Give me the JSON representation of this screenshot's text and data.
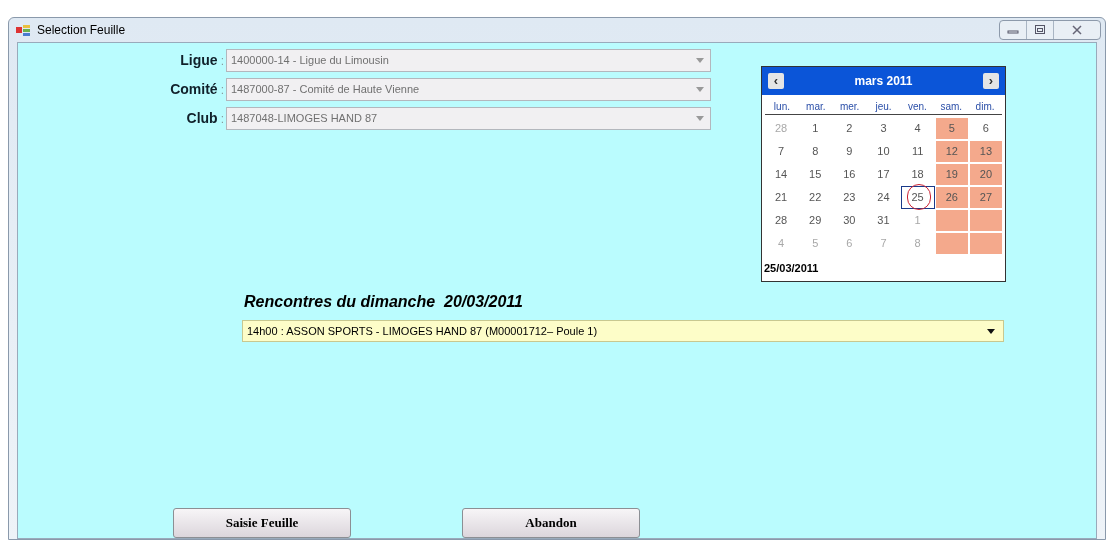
{
  "window": {
    "title": "Selection Feuille"
  },
  "fields": [
    {
      "label": "Ligue",
      "separator": ":",
      "value": "1400000-14 - Ligue du Limousin",
      "disabled": true
    },
    {
      "label": "Comité",
      "separator": ":",
      "value": "1487000-87 - Comité de Haute Vienne",
      "disabled": true
    },
    {
      "label": "Club",
      "separator": ":",
      "value": "1487048-LIMOGES HAND 87",
      "disabled": true
    }
  ],
  "calendar": {
    "month": "mars 2011",
    "prev": "‹",
    "next": "›",
    "weekdays": [
      "lun.",
      "mar.",
      "mer.",
      "jeu.",
      "ven.",
      "sam.",
      "dim."
    ],
    "weeks": [
      [
        {
          "text": "28",
          "other_month": true,
          "weekend": false,
          "selected": false
        },
        {
          "text": "1",
          "other_month": false,
          "weekend": false,
          "selected": false
        },
        {
          "text": "2",
          "other_month": false,
          "weekend": false,
          "selected": false
        },
        {
          "text": "3",
          "other_month": false,
          "weekend": false,
          "selected": false
        },
        {
          "text": "4",
          "other_month": false,
          "weekend": false,
          "selected": false
        },
        {
          "text": "5",
          "other_month": false,
          "weekend": true,
          "selected": false
        },
        {
          "text": "6",
          "other_month": false,
          "weekend": false,
          "selected": false
        }
      ],
      [
        {
          "text": "7",
          "other_month": false,
          "weekend": false,
          "selected": false
        },
        {
          "text": "8",
          "other_month": false,
          "weekend": false,
          "selected": false
        },
        {
          "text": "9",
          "other_month": false,
          "weekend": false,
          "selected": false
        },
        {
          "text": "10",
          "other_month": false,
          "weekend": false,
          "selected": false
        },
        {
          "text": "11",
          "other_month": false,
          "weekend": false,
          "selected": false
        },
        {
          "text": "12",
          "other_month": false,
          "weekend": true,
          "selected": false
        },
        {
          "text": "13",
          "other_month": false,
          "weekend": true,
          "selected": false
        }
      ],
      [
        {
          "text": "14",
          "other_month": false,
          "weekend": false,
          "selected": false
        },
        {
          "text": "15",
          "other_month": false,
          "weekend": false,
          "selected": false
        },
        {
          "text": "16",
          "other_month": false,
          "weekend": false,
          "selected": false
        },
        {
          "text": "17",
          "other_month": false,
          "weekend": false,
          "selected": false
        },
        {
          "text": "18",
          "other_month": false,
          "weekend": false,
          "selected": false
        },
        {
          "text": "19",
          "other_month": false,
          "weekend": true,
          "selected": false
        },
        {
          "text": "20",
          "other_month": false,
          "weekend": true,
          "selected": false
        }
      ],
      [
        {
          "text": "21",
          "other_month": false,
          "weekend": false,
          "selected": false
        },
        {
          "text": "22",
          "other_month": false,
          "weekend": false,
          "selected": false
        },
        {
          "text": "23",
          "other_month": false,
          "weekend": false,
          "selected": false
        },
        {
          "text": "24",
          "other_month": false,
          "weekend": false,
          "selected": false
        },
        {
          "text": "25",
          "other_month": false,
          "weekend": false,
          "selected": true
        },
        {
          "text": "26",
          "other_month": false,
          "weekend": true,
          "selected": false
        },
        {
          "text": "27",
          "other_month": false,
          "weekend": true,
          "selected": false
        }
      ],
      [
        {
          "text": "28",
          "other_month": false,
          "weekend": false,
          "selected": false
        },
        {
          "text": "29",
          "other_month": false,
          "weekend": false,
          "selected": false
        },
        {
          "text": "30",
          "other_month": false,
          "weekend": false,
          "selected": false
        },
        {
          "text": "31",
          "other_month": false,
          "weekend": false,
          "selected": false
        },
        {
          "text": "1",
          "other_month": true,
          "weekend": false,
          "selected": false
        },
        {
          "other_month": true,
          "weekend": true,
          "selected": false
        },
        {
          "other_month": true,
          "weekend": true,
          "selected": false
        }
      ],
      [
        {
          "text": "4",
          "other_month": true,
          "weekend": false,
          "selected": false
        },
        {
          "text": "5",
          "other_month": true,
          "weekend": false,
          "selected": false
        },
        {
          "text": "6",
          "other_month": true,
          "weekend": false,
          "selected": false
        },
        {
          "text": "7",
          "other_month": true,
          "weekend": false,
          "selected": false
        },
        {
          "text": "8",
          "other_month": true,
          "weekend": false,
          "selected": false
        },
        {
          "other_month": true,
          "weekend": true,
          "selected": false
        },
        {
          "other_month": true,
          "weekend": true,
          "selected": false
        }
      ]
    ],
    "today": "25/03/2011"
  },
  "matches": {
    "title": "Rencontres du dimanche  20/03/2011",
    "value": "14h00 :  ASSON SPORTS - LIMOGES HAND 87 (M00001712– Poule 1)"
  },
  "buttons": [
    "Saisie Feuille",
    "Abandon"
  ]
}
